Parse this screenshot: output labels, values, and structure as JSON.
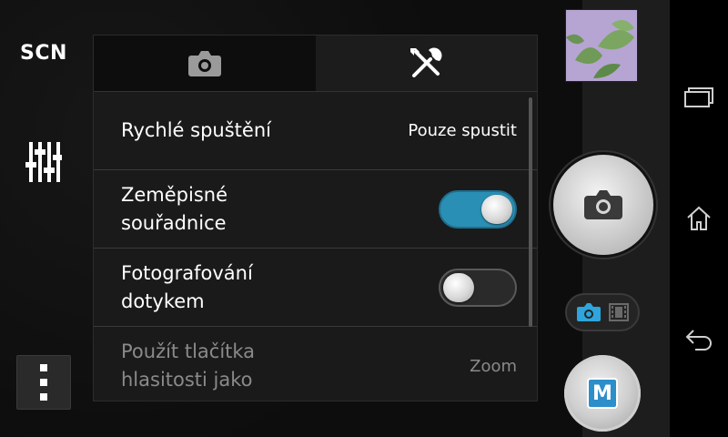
{
  "left_bar": {
    "scene_label": "SCN"
  },
  "panel": {
    "tabs": [
      {
        "icon": "camera-icon"
      },
      {
        "icon": "tools-icon"
      }
    ],
    "rows": [
      {
        "label": "Rychlé spuštění",
        "value": "Pouze spustit"
      },
      {
        "label": "Zeměpisné\nsouřadnice",
        "toggle": "on"
      },
      {
        "label": "Fotografování\ndotykem",
        "toggle": "off"
      },
      {
        "label": "Použít tlačítka\nhlasitosti jako",
        "value": "Zoom"
      }
    ]
  },
  "right_controls": {
    "mode_badge": "M"
  },
  "colors": {
    "accent": "#2a8fb4",
    "panel_bg": "#1a1a1a"
  }
}
